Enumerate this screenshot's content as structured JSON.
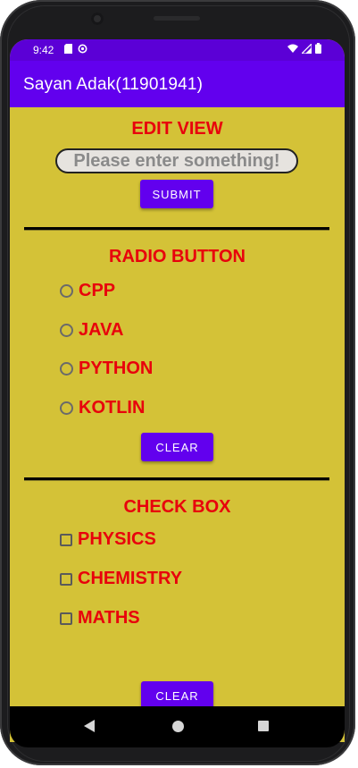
{
  "status_bar": {
    "time": "9:42",
    "left_icons": [
      "sd-card-icon",
      "sync-icon"
    ],
    "right_icons": [
      "wifi-icon",
      "signal-icon",
      "battery-icon"
    ]
  },
  "app_bar": {
    "title": "Sayan Adak(11901941)"
  },
  "edit_section": {
    "heading": "EDIT VIEW",
    "input_placeholder": "Please enter something!",
    "input_value": "",
    "submit_label": "SUBMIT"
  },
  "radio_section": {
    "heading": "RADIO BUTTON",
    "options": [
      "CPP",
      "JAVA",
      "PYTHON",
      "KOTLIN"
    ],
    "clear_label": "CLEAR"
  },
  "checkbox_section": {
    "heading": "CHECK BOX",
    "options": [
      "PHYSICS",
      "CHEMISTRY",
      "MATHS"
    ],
    "clear_label": "CLEAR"
  },
  "colors": {
    "background": "#d4c237",
    "accent": "#6200ee",
    "status_bar": "#5b00d6",
    "text_red": "#e8000c"
  },
  "nav_bar": {
    "icons": [
      "back-icon",
      "home-icon",
      "recents-icon"
    ]
  }
}
